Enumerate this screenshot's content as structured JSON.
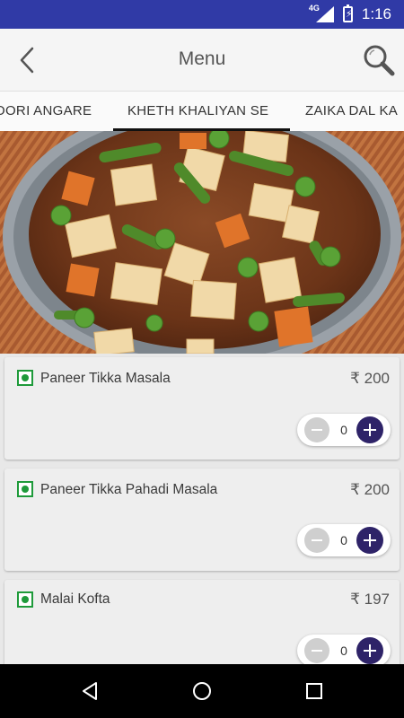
{
  "status_bar": {
    "network": "4G",
    "battery_icon": "battery-charging-icon",
    "time": "1:16"
  },
  "app_bar": {
    "title": "Menu",
    "back_icon": "back-arrow-icon",
    "search_icon": "search-icon"
  },
  "tabs": [
    {
      "label": "OORI ANGARE",
      "selected": false
    },
    {
      "label": "KHETH KHALIYAN SE",
      "selected": true
    },
    {
      "label": "ZAIKA DAL KA",
      "selected": false
    }
  ],
  "hero": {
    "image": "paneer-peas-curry-dish"
  },
  "colors": {
    "status_bar": "#303aa6",
    "veg_green": "#1e9a3a",
    "plus_button": "#2e2368",
    "minus_button": "#cfcfcf"
  },
  "menu_items": [
    {
      "name": "Paneer Tikka Masala",
      "price": "₹ 200",
      "quantity": "0"
    },
    {
      "name": "Paneer Tikka Pahadi Masala",
      "price": "₹ 200",
      "quantity": "0"
    },
    {
      "name": "Malai Kofta",
      "price": "₹ 197",
      "quantity": "0"
    }
  ],
  "nav_bar": {
    "back_icon": "nav-back-icon",
    "home_icon": "nav-home-icon",
    "recents_icon": "nav-recents-icon"
  }
}
